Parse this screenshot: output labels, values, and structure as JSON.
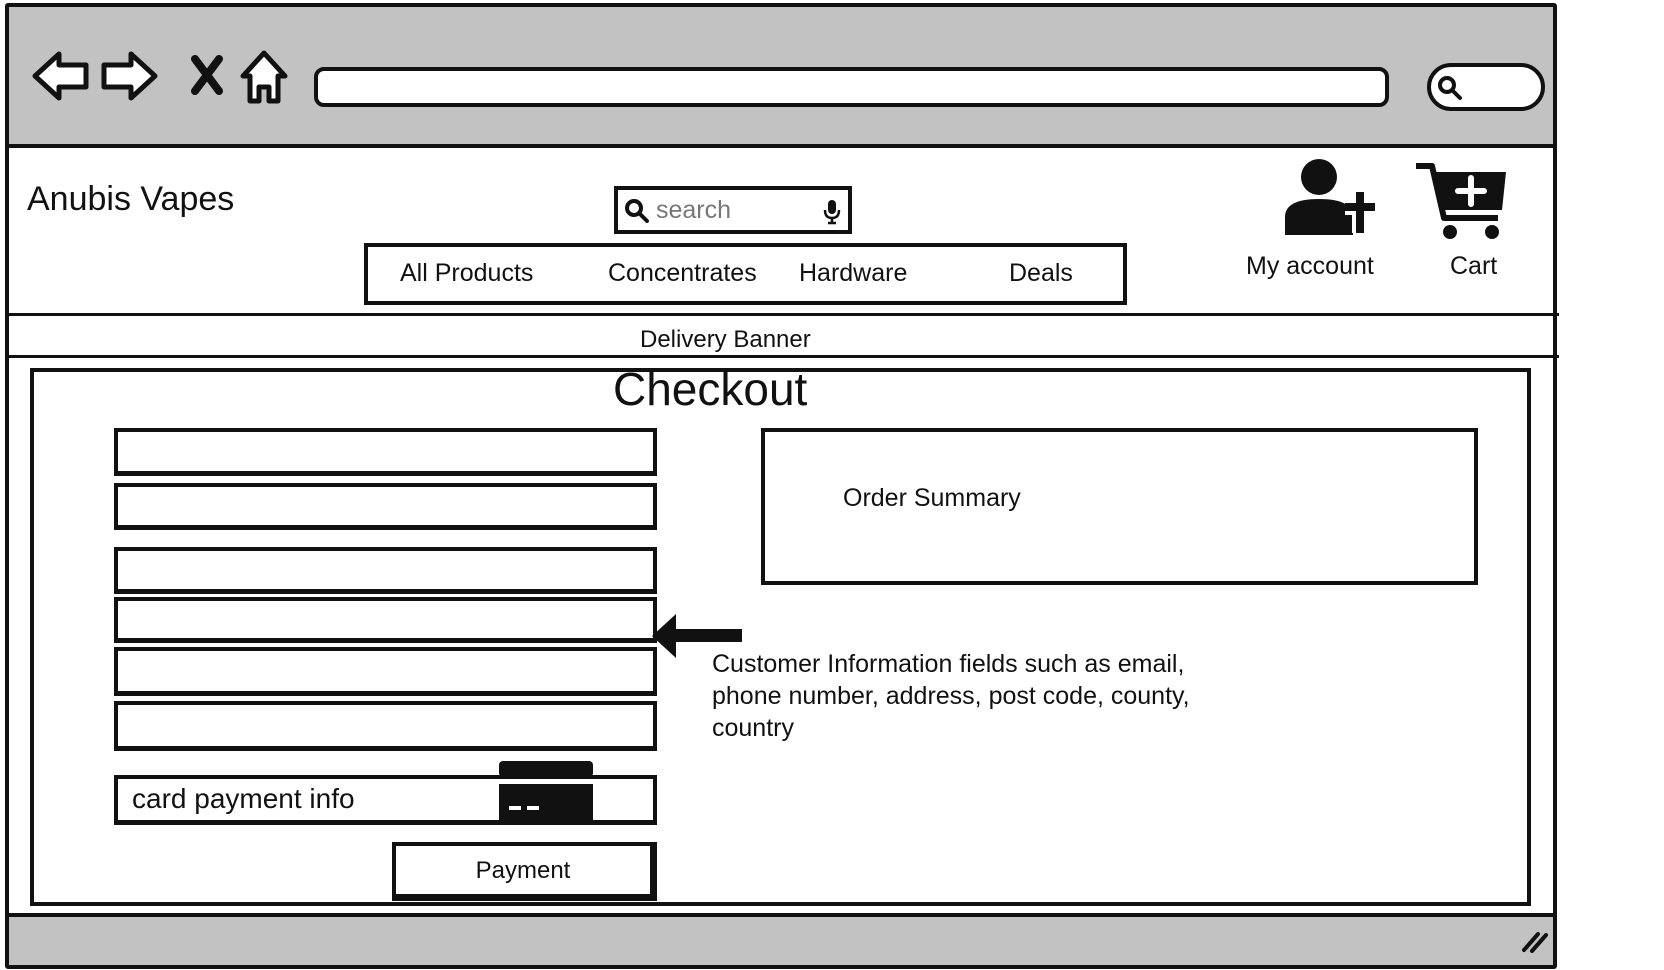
{
  "browser": {
    "back_icon": "back-arrow-icon",
    "forward_icon": "forward-arrow-icon",
    "stop_icon": "stop-icon",
    "home_icon": "home-icon",
    "address_value": "",
    "search_icon": "search-icon"
  },
  "header": {
    "brand": "Anubis Vapes",
    "search": {
      "placeholder": "search",
      "icon": "search-icon",
      "mic_icon": "microphone-icon"
    },
    "nav": [
      "All Products",
      "Concentrates",
      "Hardware",
      "Deals"
    ],
    "account": {
      "label": "My account",
      "icon": "add-user-icon"
    },
    "cart": {
      "label": "Cart",
      "icon": "cart-add-icon"
    }
  },
  "banner": {
    "label": "Delivery Banner"
  },
  "checkout": {
    "title": "Checkout",
    "fields": [
      "",
      "",
      "",
      "",
      "",
      ""
    ],
    "card_field": {
      "label": "card payment info",
      "icon": "credit-card-icon"
    },
    "payment_button": "Payment",
    "order_summary": "Order Summary",
    "annotation": "Customer Information fields such as email, phone number, address, post code, county, country",
    "annotation_arrow_icon": "left-arrow-icon"
  },
  "footer": {
    "resize_icon": "resize-grip-icon"
  }
}
